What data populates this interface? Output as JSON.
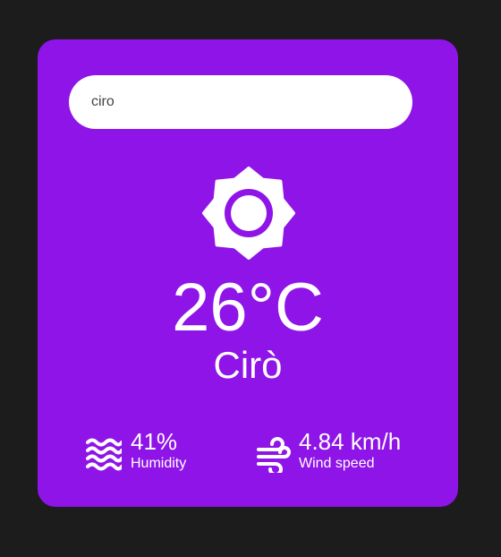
{
  "search": {
    "value": "ciro"
  },
  "weather": {
    "icon": "sun-icon",
    "temperature": "26°C",
    "city": "Cirò"
  },
  "stats": {
    "humidity": {
      "icon": "humidity-waves-icon",
      "value": "41%",
      "label": "Humidity"
    },
    "wind": {
      "icon": "wind-icon",
      "value": "4.84 km/h",
      "label": "Wind speed"
    }
  },
  "colors": {
    "page_background": "#1c1c1c",
    "card_background": "#8f14e8",
    "text": "#ffffff",
    "search_background": "#ffffff"
  }
}
